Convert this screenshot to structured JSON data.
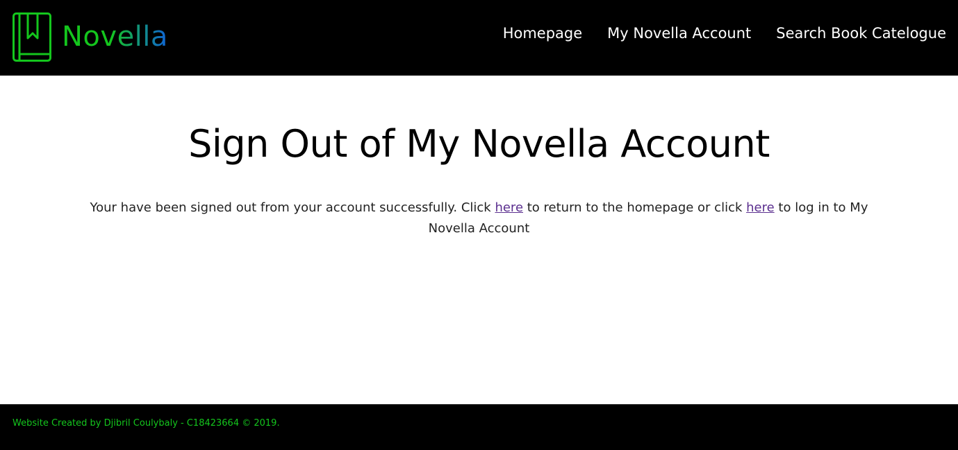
{
  "brand": {
    "name": "Novella",
    "icon": "book-bookmark-icon",
    "colors": {
      "primary_green": "#14c61d",
      "accent_blue": "#0f62d8"
    }
  },
  "nav": {
    "items": [
      {
        "label": "Homepage"
      },
      {
        "label": "My Novella Account"
      },
      {
        "label": "Search Book Catelogue"
      }
    ]
  },
  "page": {
    "title": "Sign Out of My Novella Account",
    "message": {
      "before_first_link": "Your have been signed out from your account successfully. Click ",
      "first_link": "here",
      "between_links": " to return to the homepage or click ",
      "second_link": "here",
      "after_second_link": " to log in to My Novella Account"
    }
  },
  "footer": {
    "text": "Website Created by Djibril Coulybaly - C18423664 © 2019."
  },
  "colors": {
    "header_bg": "#000000",
    "footer_bg": "#000000",
    "link_visited": "#5b2f8f",
    "footer_text": "#14c61d"
  }
}
